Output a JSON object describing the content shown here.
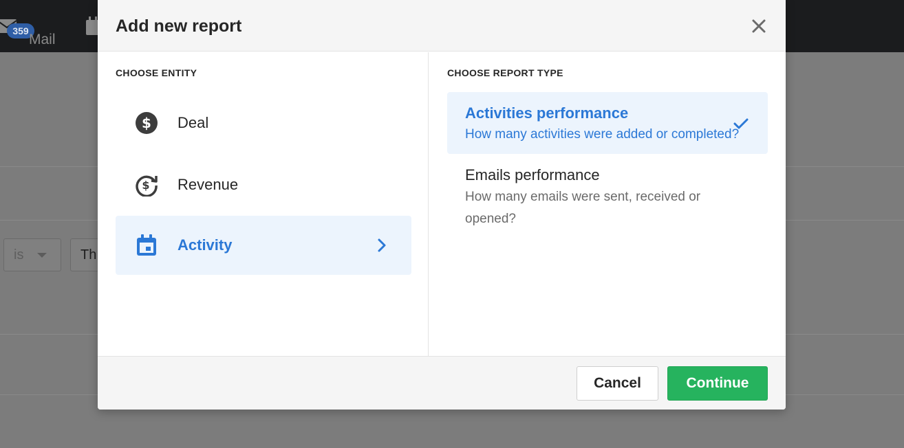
{
  "background": {
    "mail_badge": "359",
    "mail_label": "Mail",
    "filter_operator": "is",
    "filter_value": "Th"
  },
  "modal": {
    "title": "Add new report",
    "entity_section_label": "CHOOSE ENTITY",
    "report_type_section_label": "CHOOSE REPORT TYPE",
    "entities": [
      {
        "label": "Deal",
        "icon": "dollar-circle-icon",
        "selected": false
      },
      {
        "label": "Revenue",
        "icon": "revenue-cycle-icon",
        "selected": false
      },
      {
        "label": "Activity",
        "icon": "calendar-icon",
        "selected": true
      }
    ],
    "report_types": [
      {
        "title": "Activities performance",
        "description": "How many activities were added or completed?",
        "selected": true
      },
      {
        "title": "Emails performance",
        "description": "How many emails were sent, received or opened?",
        "selected": false
      }
    ],
    "cancel_label": "Cancel",
    "continue_label": "Continue"
  },
  "colors": {
    "accent_blue": "#2b78d6",
    "selected_bg": "#ecf4fd",
    "continue_green": "#26b35e"
  }
}
